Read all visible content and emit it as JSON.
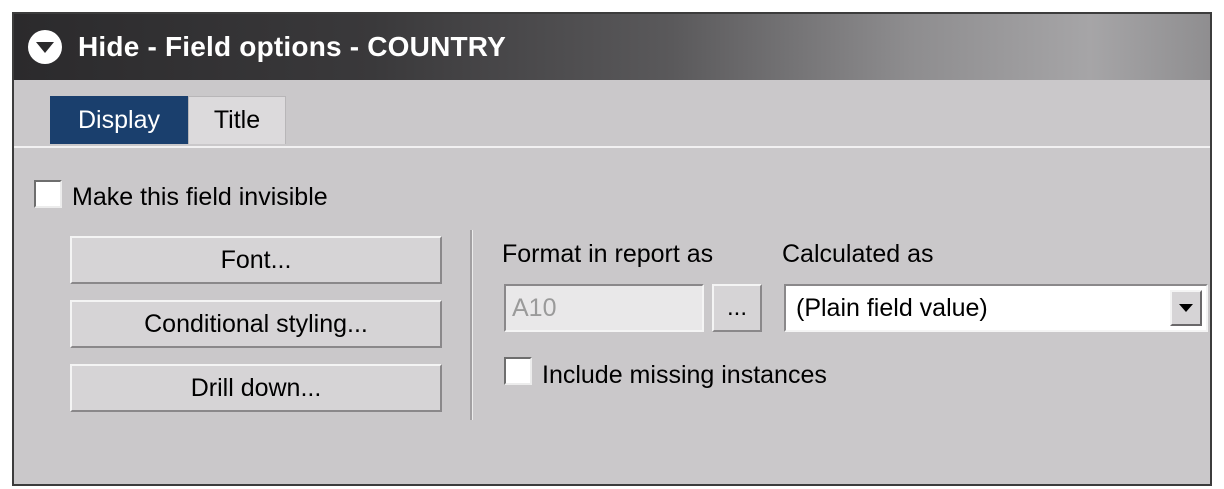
{
  "header": {
    "title": "Hide - Field options - COUNTRY",
    "toggle_icon": "chevron-down-circle-icon"
  },
  "tabs": [
    {
      "label": "Display",
      "active": true
    },
    {
      "label": "Title",
      "active": false
    }
  ],
  "options": {
    "invisible_label": "Make this field invisible",
    "invisible_checked": false
  },
  "buttons": {
    "font": "Font...",
    "conditional_styling": "Conditional styling...",
    "drill_down": "Drill down..."
  },
  "format": {
    "label": "Format in report as",
    "value": "A10",
    "browse_label": "..."
  },
  "calculated": {
    "label": "Calculated as",
    "selected": "(Plain field value)"
  },
  "missing": {
    "label": "Include missing instances",
    "checked": false
  },
  "colors": {
    "active_tab": "#1a3f6d",
    "panel_bg": "#cac8ca",
    "titlebar_dark": "#2b2a2c"
  }
}
